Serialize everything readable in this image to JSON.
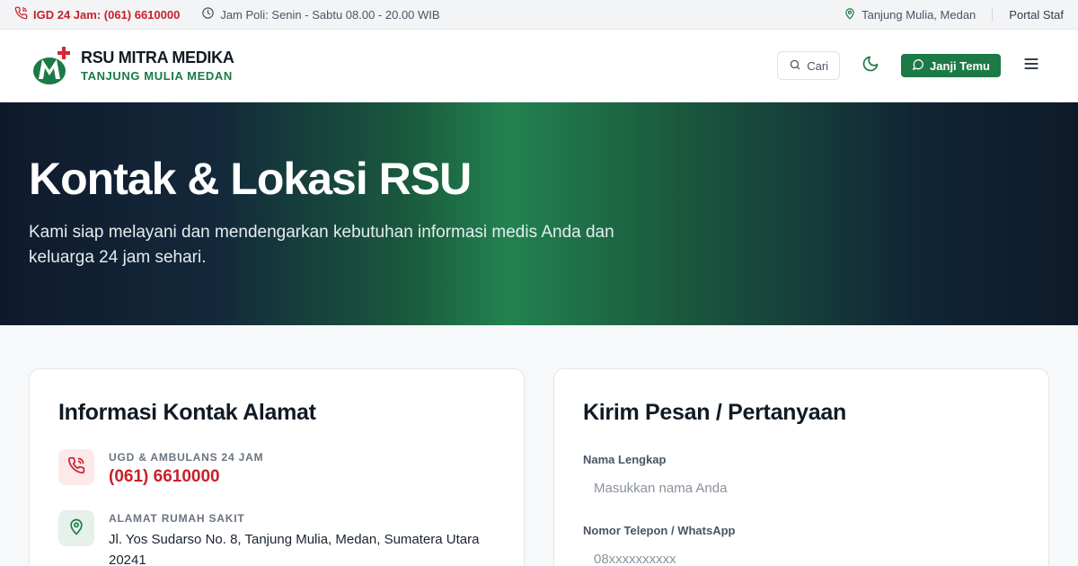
{
  "topbar": {
    "igd": "IGD 24 Jam: (061) 6610000",
    "hours": "Jam Poli: Senin - Sabtu 08.00 - 20.00 WIB",
    "location": "Tanjung Mulia, Medan",
    "portal": "Portal Staf"
  },
  "header": {
    "name": "RSU MITRA MEDIKA",
    "sub": "TANJUNG MULIA MEDAN",
    "search_label": "Cari",
    "cta_label": "Janji Temu"
  },
  "hero": {
    "title": "Kontak & Lokasi RSU",
    "subtitle": "Kami siap melayani dan mendengarkan kebutuhan informasi medis Anda dan keluarga 24 jam sehari."
  },
  "contact": {
    "title": "Informasi Kontak Alamat",
    "emergency_label": "UGD & AMBULANS 24 JAM",
    "emergency_phone": "(061) 6610000",
    "address_label": "ALAMAT RUMAH SAKIT",
    "address": "Jl. Yos Sudarso No. 8, Tanjung Mulia, Medan, Sumatera Utara 20241"
  },
  "form": {
    "title": "Kirim Pesan / Pertanyaan",
    "name_label": "Nama Lengkap",
    "name_placeholder": "Masukkan nama Anda",
    "phone_label": "Nomor Telepon / WhatsApp",
    "phone_placeholder": "08xxxxxxxxxx"
  },
  "colors": {
    "brand_green": "#1b7a45",
    "emergency_red": "#c8202a",
    "hero_dark": "#0e1a2c"
  },
  "icons": [
    "phone-icon",
    "clock-icon",
    "map-pin-icon",
    "search-icon",
    "moon-icon",
    "chat-icon",
    "menu-icon"
  ]
}
